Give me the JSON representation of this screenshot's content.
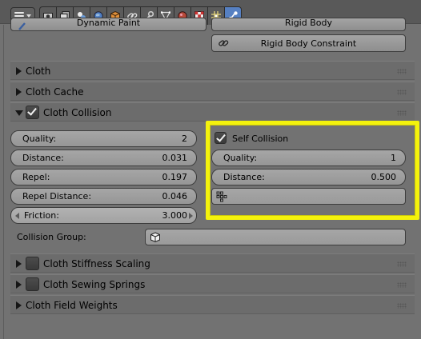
{
  "header": {
    "editor_icon": "properties-editor-icon",
    "tabs": [
      {
        "icon": "render-icon",
        "active": false
      },
      {
        "icon": "render-layers-icon",
        "active": false
      },
      {
        "icon": "scene-icon",
        "active": false
      },
      {
        "icon": "world-icon",
        "active": false
      },
      {
        "icon": "object-icon",
        "active": false
      },
      {
        "icon": "constraints-icon",
        "active": false
      },
      {
        "icon": "modifier-wrench-icon",
        "active": false
      },
      {
        "icon": "object-data-icon",
        "active": false
      },
      {
        "icon": "material-icon",
        "active": false
      },
      {
        "icon": "texture-icon",
        "active": false
      },
      {
        "icon": "particles-icon",
        "active": false
      },
      {
        "icon": "physics-icon",
        "active": true
      }
    ]
  },
  "physics_buttons": {
    "dynamic_paint": "Dynamic Paint",
    "rigid_body": "Rigid Body",
    "rigid_body_constraint": "Rigid Body Constraint"
  },
  "sections": {
    "cloth": "Cloth",
    "cloth_cache": "Cloth Cache",
    "cloth_collision": "Cloth Collision",
    "cloth_stiffness_scaling": "Cloth Stiffness Scaling",
    "cloth_sewing_springs": "Cloth Sewing Springs",
    "cloth_field_weights": "Cloth Field Weights"
  },
  "collision": {
    "quality": {
      "label": "Quality:",
      "value": "2"
    },
    "distance": {
      "label": "Distance:",
      "value": "0.031"
    },
    "repel": {
      "label": "Repel:",
      "value": "0.197"
    },
    "repel_distance": {
      "label": "Repel Distance:",
      "value": "0.046"
    },
    "friction": {
      "label": "Friction:",
      "value": "3.000"
    },
    "collision_group_label": "Collision Group:",
    "self_collision": {
      "label": "Self Collision",
      "checked": true,
      "quality": {
        "label": "Quality:",
        "value": "1"
      },
      "distance": {
        "label": "Distance:",
        "value": "0.500"
      }
    }
  },
  "colors": {
    "highlight": "#f4f20c",
    "active_tab": "#5680c2",
    "panel": "#727272"
  }
}
